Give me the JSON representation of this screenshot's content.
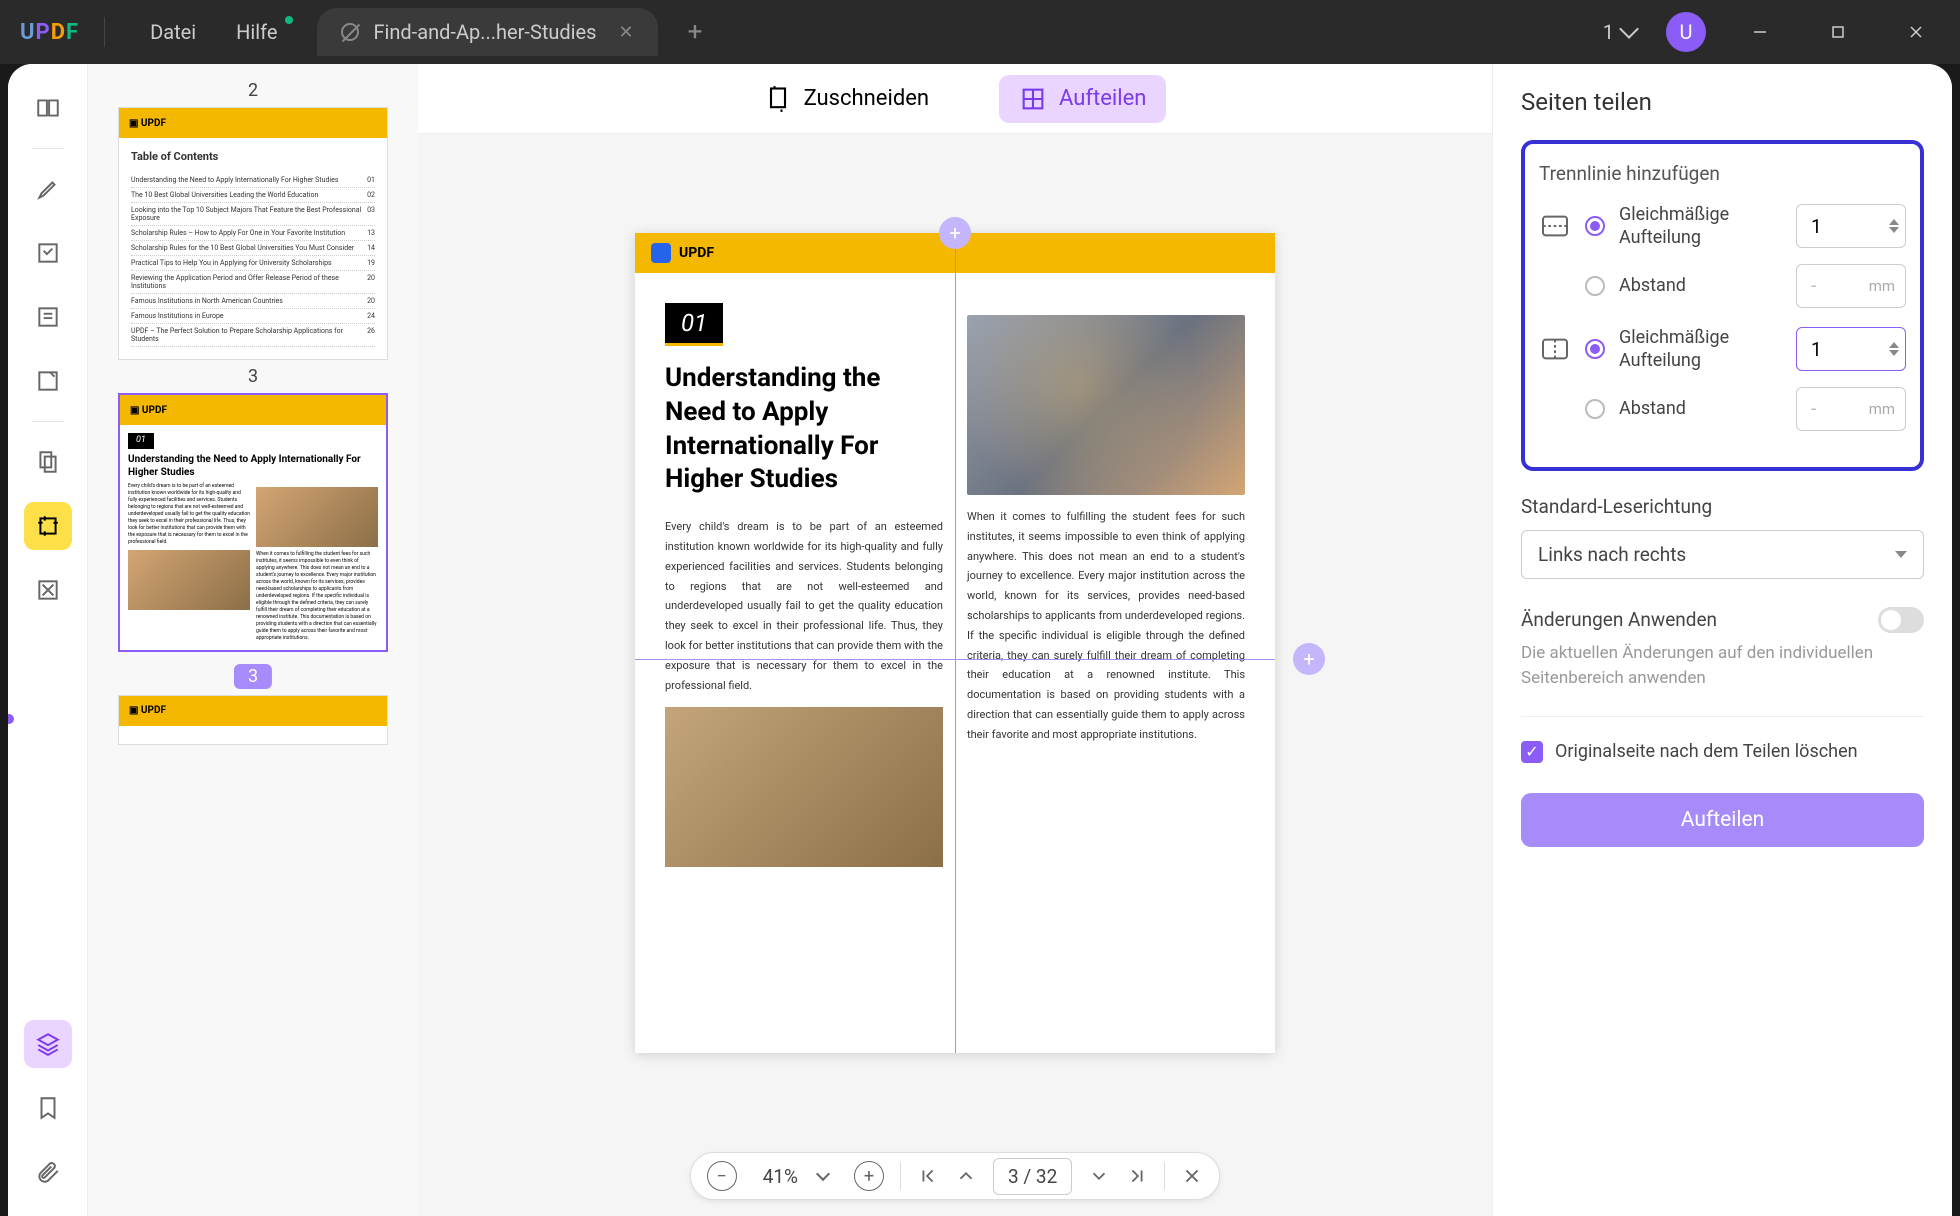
{
  "titlebar": {
    "logo": "UPDF",
    "menu": {
      "file": "Datei",
      "help": "Hilfe"
    },
    "tab": {
      "title": "Find-and-Ap...her-Studies"
    },
    "cloud_count": "1",
    "avatar_letter": "U"
  },
  "thumbnails": {
    "page2_num": "2",
    "page3_num": "3",
    "toc_title": "Table of Contents",
    "toc": [
      {
        "t": "Understanding the Need to Apply Internationally For Higher Studies",
        "p": "01"
      },
      {
        "t": "The 10 Best Global Universities Leading the World Education",
        "p": "02"
      },
      {
        "t": "Looking into the Top 10 Subject Majors That Feature the Best Professional Exposure",
        "p": "03"
      },
      {
        "t": "Scholarship Rules – How to Apply For One in Your Favorite Institution",
        "p": "13"
      },
      {
        "t": "Scholarship Rules for the 10 Best Global Universities You Must Consider",
        "p": "14"
      },
      {
        "t": "Practical Tips to Help You in Applying for University Scholarships",
        "p": "19"
      },
      {
        "t": "Reviewing the Application Period and Offer Release Period of these Institutions",
        "p": "20"
      },
      {
        "t": "Famous Institutions in North American Countries",
        "p": "20"
      },
      {
        "t": "Famous Institutions in Europe",
        "p": "24"
      },
      {
        "t": "UPDF – The Perfect Solution to Prepare Scholarship Applications for Students",
        "p": "26"
      }
    ]
  },
  "center": {
    "crop_label": "Zuschneiden",
    "split_label": "Aufteilen"
  },
  "doc": {
    "brand": "UPDF",
    "chapter": "01",
    "title": "Understanding the Need to Apply Internationally For Higher Studies",
    "para1": "Every child's dream is to be part of an esteemed institution known worldwide for its high-quality and fully experienced facilities and services. Students belonging to regions that are not well-esteemed and underdeveloped usually fail to get the quality education they seek to excel in their professional life. Thus, they look for better institutions that can provide them with the exposure that is necessary for them to excel in the professional field.",
    "para2": "When it comes to fulfilling the student fees for such institutes, it seems impossible to even think of applying anywhere. This does not mean an end to a student's journey to excellence. Every major institution across the world, known for its services, provides need-based scholarships to applicants from underdeveloped regions. If the specific individual is eligible through the defined criteria, they can surely fulfill their dream of completing their education at a renowned institute. This documentation is based on providing students with a direction that can essentially guide them to apply across their favorite and most appropriate institutions."
  },
  "bottom": {
    "zoom": "41%",
    "page_display": "3 / 32"
  },
  "panel": {
    "title": "Seiten teilen",
    "add_divider": "Trennlinie hinzufügen",
    "equal_split": "Gleichmäßige Aufteilung",
    "distance": "Abstand",
    "h_value": "1",
    "v_value": "1",
    "distance_placeholder": "-",
    "unit": "mm",
    "reading_dir_label": "Standard-Leserichtung",
    "reading_dir_value": "Links nach rechts",
    "apply_changes": "Änderungen Anwenden",
    "apply_help": "Die aktuellen Änderungen auf den individuellen Seitenbereich anwenden",
    "delete_original": "Originalseite nach dem Teilen löschen",
    "split_button": "Aufteilen"
  }
}
